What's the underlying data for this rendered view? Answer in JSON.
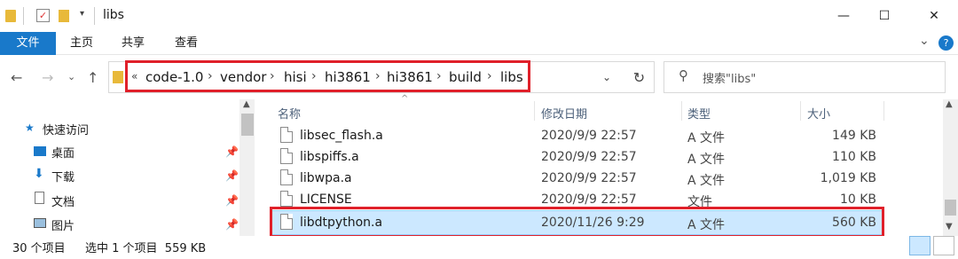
{
  "window": {
    "title": "libs",
    "controls": {
      "minimize": "—",
      "maximize": "☐",
      "close": "✕"
    }
  },
  "ribbon": {
    "tabs": [
      "文件",
      "主页",
      "共享",
      "查看"
    ],
    "expand_glyph": "⌄",
    "help_glyph": "?"
  },
  "address": {
    "crumbs": [
      "code-1.0",
      "vendor",
      "hisi",
      "hi3861",
      "hi3861",
      "build",
      "libs"
    ],
    "overflow": "«",
    "search_placeholder": "搜索\"libs\""
  },
  "sidebar": {
    "items": [
      {
        "label": "快速访问",
        "icon": "star-icon",
        "pinned": false
      },
      {
        "label": "桌面",
        "icon": "desktop-icon",
        "pinned": true
      },
      {
        "label": "下载",
        "icon": "download-icon",
        "pinned": true
      },
      {
        "label": "文档",
        "icon": "document-icon",
        "pinned": true
      },
      {
        "label": "图片",
        "icon": "picture-icon",
        "pinned": true
      }
    ]
  },
  "list": {
    "headers": {
      "name": "名称",
      "date": "修改日期",
      "type": "类型",
      "size": "大小"
    },
    "rows": [
      {
        "name": "libsec_flash.a",
        "date": "2020/9/9 22:57",
        "type": "A 文件",
        "size": "149 KB",
        "selected": false
      },
      {
        "name": "libspiffs.a",
        "date": "2020/9/9 22:57",
        "type": "A 文件",
        "size": "110 KB",
        "selected": false
      },
      {
        "name": "libwpa.a",
        "date": "2020/9/9 22:57",
        "type": "A 文件",
        "size": "1,019 KB",
        "selected": false
      },
      {
        "name": "LICENSE",
        "date": "2020/9/9 22:57",
        "type": "文件",
        "size": "10 KB",
        "selected": false
      },
      {
        "name": "libdtpython.a",
        "date": "2020/11/26 9:29",
        "type": "A 文件",
        "size": "560 KB",
        "selected": true
      }
    ]
  },
  "status": {
    "count": "30 个项目",
    "selection": "选中 1 个项目  559 KB"
  },
  "colors": {
    "accent": "#1979ca",
    "highlight": "#e0202a",
    "selection": "#cce8ff"
  }
}
